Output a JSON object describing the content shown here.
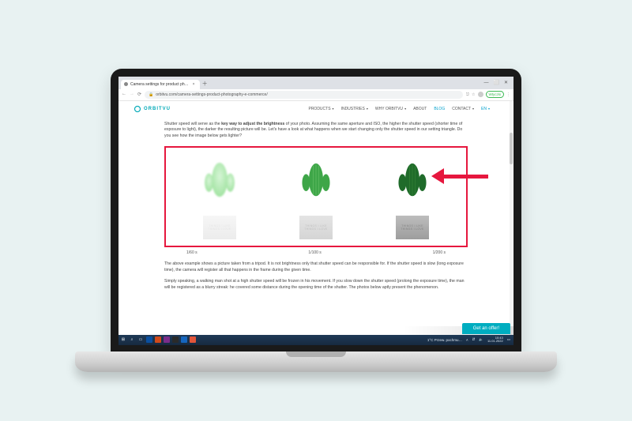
{
  "browser": {
    "tab_title": "Camera settings for product ph…",
    "url": "orbitvu.com/camera-settings-product-photography-e-commerce/",
    "badge": "Wtyczki",
    "window_min": "—",
    "window_max": "⬜",
    "window_close": "✕"
  },
  "site": {
    "brand": "ORBITVU",
    "nav": {
      "products": "PRODUCTS",
      "industries": "INDUSTRIES",
      "why": "WHY ORBITVU",
      "about": "ABOUT",
      "blog": "BLOG",
      "contact": "CONTACT",
      "lang": "EN"
    }
  },
  "article": {
    "p1_a": "Shutter speed will serve as the ",
    "p1_bold": "key way to adjust the brightness",
    "p1_b": " of your photo. Assuming the same aperture and ISO, the higher the shutter speed (shorter time of exposure to light), the darker the resulting picture will be. Let's have a look at what happens when we start changing only the shutter speed in our setting triangle. Do you see how the image below gets lighter?",
    "caption1": "1/60 s",
    "caption2": "1/100 s",
    "caption3": "1/200 s",
    "p2": "The above example shows a picture taken from a tripod. It is not brightness only that shutter speed can be responsible for. If the shutter speed is slow (long exposure time), the camera will register all that happens in the frame during the given time.",
    "p3": "Simply speaking, a walking man shot at a high shutter speed will be frozen in his movement. If you slow down the shutter speed (prolong the exposure time), the man will be registered as a blurry streak: he covered some distance during the opening time of the shutter. The photos below aptly present the phenomenon.",
    "pot_text": "THINGS I LIKE THINGS I LOVE"
  },
  "cta": {
    "label": "Get an offer!"
  },
  "taskbar": {
    "weather": "1°C  Przew. pochmu…",
    "time": "10:43",
    "date": "11.01.2022"
  }
}
